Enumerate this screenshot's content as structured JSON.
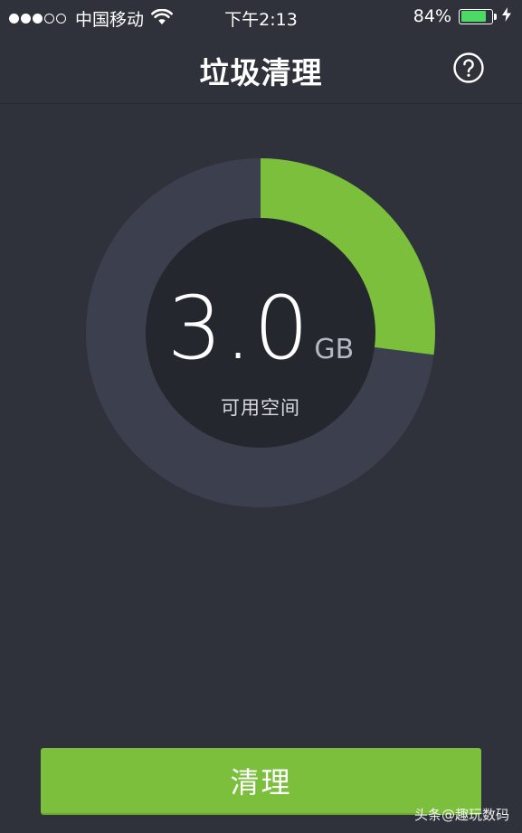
{
  "status_bar": {
    "signal_bars_filled": 3,
    "signal_bars_total": 5,
    "carrier": "中国移动",
    "time": "下午2:13",
    "battery_percent": "84%",
    "battery_level": 0.84,
    "battery_color": "#4cd964"
  },
  "nav": {
    "title": "垃圾清理",
    "help_icon": "help-circle-icon"
  },
  "storage": {
    "value": "3.0",
    "unit": "GB",
    "label": "可用空间",
    "used_fraction": 0.27,
    "used_color": "#7bbf3c",
    "remaining_color": "#3c404e",
    "inner_color": "#24272e"
  },
  "action": {
    "clean_label": "清理",
    "button_color": "#7bbf3c"
  },
  "watermark": {
    "text": "头条@趣玩数码"
  }
}
